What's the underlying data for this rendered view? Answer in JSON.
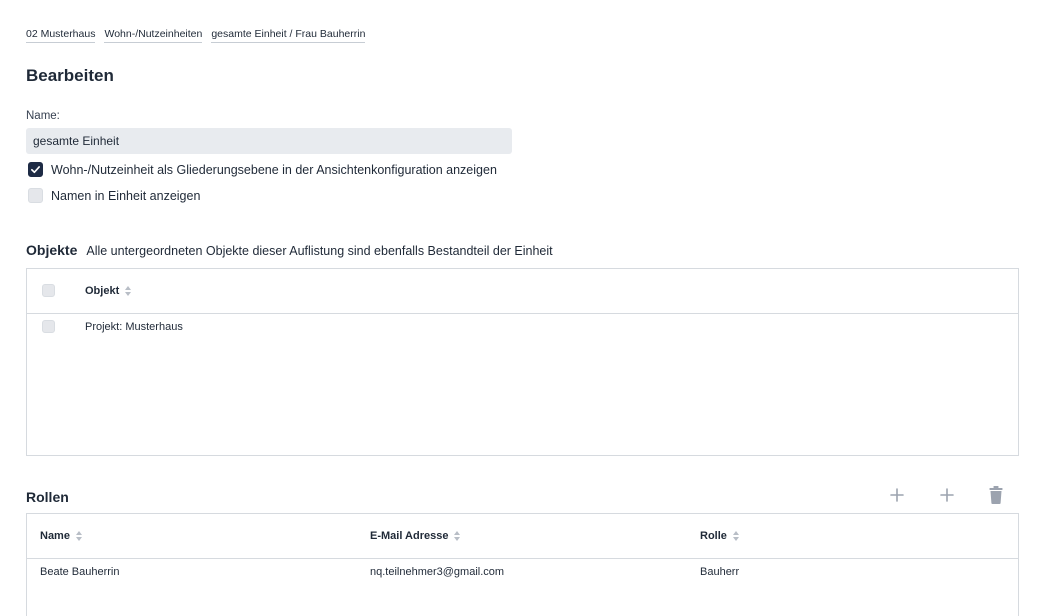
{
  "breadcrumb": [
    "02 Musterhaus",
    "Wohn-/Nutzeinheiten",
    "gesamte Einheit / Frau Bauherrin"
  ],
  "page_title": "Bearbeiten",
  "form": {
    "name_label": "Name:",
    "name_value": "gesamte Einheit",
    "checkbox_gliederung": {
      "label": "Wohn-/Nutzeinheit als Gliederungsebene in der Ansichtenkonfiguration anzeigen",
      "checked": true
    },
    "checkbox_namen": {
      "label": "Namen in Einheit anzeigen",
      "checked": false
    }
  },
  "objekte": {
    "title": "Objekte",
    "description": "Alle untergeordneten Objekte dieser Auflistung sind ebenfalls Bestandteil der Einheit",
    "column_header": "Objekt",
    "rows": [
      {
        "objekt": "Projekt: Musterhaus"
      }
    ]
  },
  "rollen": {
    "title": "Rollen",
    "columns": [
      "Name",
      "E-Mail Adresse",
      "Rolle"
    ],
    "rows": [
      {
        "name": "Beate Bauherrin",
        "email": "nq.teilnehmer3@gmail.com",
        "rolle": "Bauherr"
      }
    ],
    "toolbar_icons": [
      "plus-icon",
      "plus-icon",
      "trash-icon"
    ]
  },
  "colors": {
    "accent": "#1e2b45",
    "input_bg": "#e8ebef",
    "border": "#d6dadf",
    "icon_muted": "#9ca3af"
  }
}
